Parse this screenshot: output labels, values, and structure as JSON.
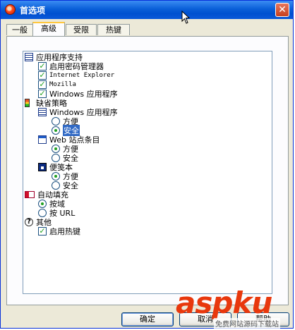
{
  "window": {
    "title": "首选项",
    "close_glyph": "✕"
  },
  "tabs": [
    {
      "label": "一般",
      "active": false
    },
    {
      "label": "高级",
      "active": true
    },
    {
      "label": "受限",
      "active": false
    },
    {
      "label": "热键",
      "active": false
    }
  ],
  "tree": {
    "app_support": {
      "label": "应用程序支持",
      "icon": "list-icon",
      "items": [
        {
          "label": "启用密码管理器",
          "checked": true
        },
        {
          "label": "Internet Explorer",
          "checked": true
        },
        {
          "label": "Mozilla",
          "checked": true
        },
        {
          "label": "Windows 应用程序",
          "checked": true
        }
      ]
    },
    "default_policy": {
      "label": "缺省策略",
      "icon": "traffic-light-icon",
      "groups": [
        {
          "label": "Windows 应用程序",
          "icon": "list-icon",
          "options": [
            {
              "label": "方便",
              "selected": false
            },
            {
              "label": "安全",
              "selected": true
            }
          ]
        },
        {
          "label": "Web 站点条目",
          "icon": "window-icon",
          "options": [
            {
              "label": "方便",
              "selected": true
            },
            {
              "label": "安全",
              "selected": false
            }
          ]
        },
        {
          "label": "便笺本",
          "icon": "notepad-icon",
          "options": [
            {
              "label": "方便",
              "selected": true
            },
            {
              "label": "安全",
              "selected": false
            }
          ]
        }
      ]
    },
    "autofill": {
      "label": "自动填充",
      "icon": "autofill-icon",
      "options": [
        {
          "label": "按域",
          "selected": true
        },
        {
          "label": "按 URL",
          "selected": false
        }
      ]
    },
    "other": {
      "label": "其他",
      "icon": "help-icon",
      "items": [
        {
          "label": "启用热键",
          "checked": true
        }
      ]
    }
  },
  "buttons": {
    "ok": "确定",
    "cancel": "取消",
    "help": "帮助"
  },
  "watermark": {
    "text": "aspku",
    "sub": "免费网站源码下载站"
  },
  "colors": {
    "title_bar": "#0a5fd8",
    "check": "#21a121",
    "selection": "#316ac5"
  }
}
